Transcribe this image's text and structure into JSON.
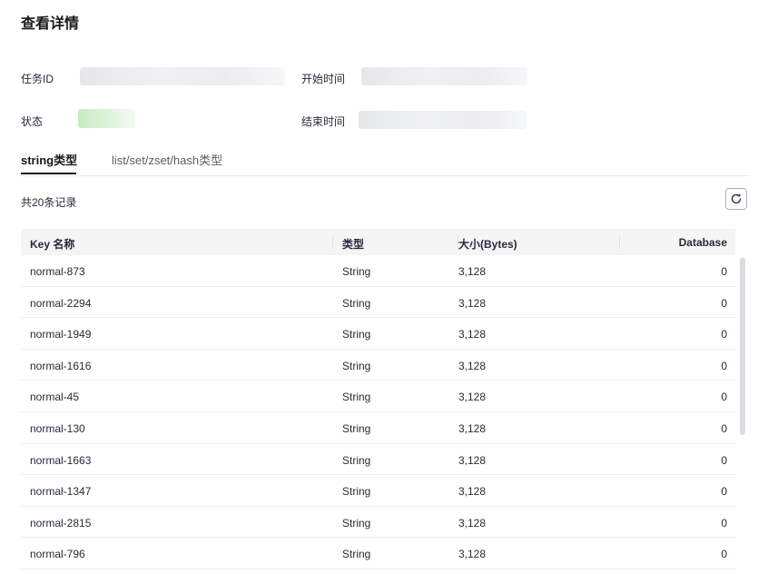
{
  "page": {
    "title": "查看详情"
  },
  "info": {
    "task_id_label": "任务ID",
    "start_time_label": "开始时间",
    "status_label": "状态",
    "end_time_label": "结束时间"
  },
  "tabs": [
    {
      "label": "string类型",
      "active": true
    },
    {
      "label": "list/set/zset/hash类型",
      "active": false
    }
  ],
  "record_count": "共20条记录",
  "table": {
    "columns": [
      "Key 名称",
      "类型",
      "大小(Bytes)",
      "Database"
    ],
    "rows": [
      {
        "key": "normal-873",
        "type": "String",
        "size": "3,128",
        "db": "0"
      },
      {
        "key": "normal-2294",
        "type": "String",
        "size": "3,128",
        "db": "0"
      },
      {
        "key": "normal-1949",
        "type": "String",
        "size": "3,128",
        "db": "0"
      },
      {
        "key": "normal-1616",
        "type": "String",
        "size": "3,128",
        "db": "0"
      },
      {
        "key": "normal-45",
        "type": "String",
        "size": "3,128",
        "db": "0"
      },
      {
        "key": "normal-130",
        "type": "String",
        "size": "3,128",
        "db": "0"
      },
      {
        "key": "normal-1663",
        "type": "String",
        "size": "3,128",
        "db": "0"
      },
      {
        "key": "normal-1347",
        "type": "String",
        "size": "3,128",
        "db": "0"
      },
      {
        "key": "normal-2815",
        "type": "String",
        "size": "3,128",
        "db": "0"
      },
      {
        "key": "normal-796",
        "type": "String",
        "size": "3,128",
        "db": "0"
      }
    ]
  },
  "icons": {
    "refresh": "refresh-icon"
  },
  "colors": {
    "text": "#252b3a",
    "header_bg": "#f5f5f6",
    "status_blur": "#c9ebc3"
  }
}
